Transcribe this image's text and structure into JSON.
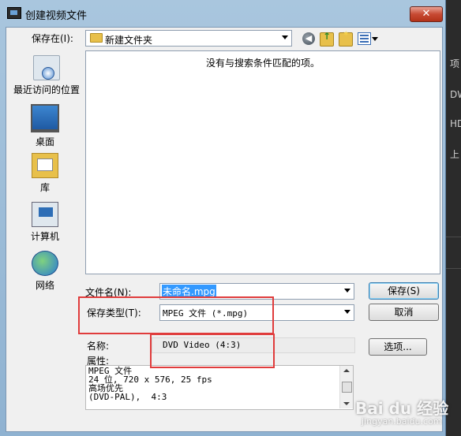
{
  "window": {
    "title": "创建视频文件",
    "close_label": "✕"
  },
  "toolbar": {
    "save_in_label": "保存在(I):",
    "save_in_value": "新建文件夹",
    "back_glyph": "◀"
  },
  "places": [
    {
      "label": "最近访问的位置",
      "icon": "recent-places-icon"
    },
    {
      "label": "桌面",
      "icon": "desktop-icon"
    },
    {
      "label": "库",
      "icon": "library-icon"
    },
    {
      "label": "计算机",
      "icon": "computer-icon"
    },
    {
      "label": "网络",
      "icon": "network-icon"
    }
  ],
  "file_list": {
    "empty_message": "没有与搜索条件匹配的项。"
  },
  "form": {
    "filename_label": "文件名(N):",
    "filename_value": "未命名.mpg",
    "savetype_label": "保存类型(T):",
    "savetype_value": "MPEG 文件 (*.mpg)",
    "name_label": "名称:",
    "name_value": "DVD Video (4:3)",
    "props_label": "属性:",
    "props_lines": [
      "MPEG 文件",
      "24 位, 720 x 576, 25 fps",
      "高场优先",
      "(DVD-PAL),  4:3"
    ]
  },
  "buttons": {
    "save": "保存(S)",
    "cancel": "取消",
    "options": "选项..."
  },
  "background_app": {
    "items": [
      "项",
      "DW",
      "HD",
      "上"
    ]
  },
  "watermark": {
    "brand": "Bai du 经验",
    "url": "jingyan.baidu.com"
  },
  "colors": {
    "highlight_box": "#e03c3c",
    "selection": "#3399ff",
    "title_gradient_top": "#a9c6de"
  }
}
